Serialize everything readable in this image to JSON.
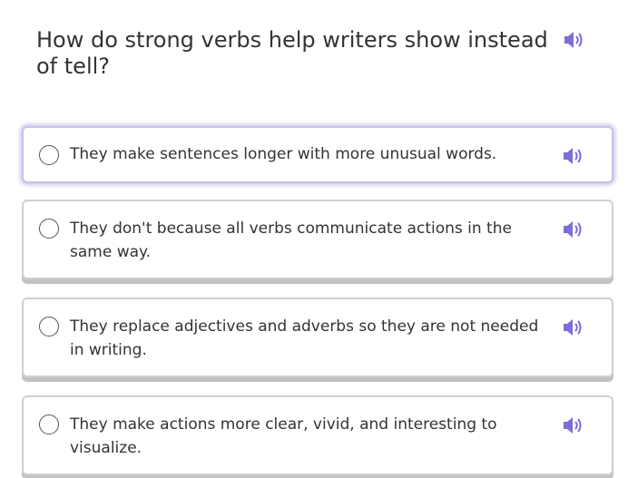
{
  "question": {
    "text": "How do strong verbs help writers show instead of tell?",
    "audio_icon": "speaker-icon"
  },
  "choices": [
    {
      "label": "They make sentences longer with more unusual words.",
      "state": "hovered",
      "audio_icon": "speaker-icon"
    },
    {
      "label": "They don't because all verbs communicate actions in the same way.",
      "state": "default",
      "audio_icon": "speaker-icon"
    },
    {
      "label": "They replace adjectives and adverbs so they are not needed in writing.",
      "state": "default",
      "audio_icon": "speaker-icon"
    },
    {
      "label": "They make actions more clear, vivid, and interesting to visualize.",
      "state": "default",
      "audio_icon": "speaker-icon"
    }
  ],
  "colors": {
    "speaker": "#7b6fd6",
    "hover_glow": "#8c80d6",
    "card_border": "#d0d0d0",
    "card_shadow": "#c2c2c2"
  }
}
